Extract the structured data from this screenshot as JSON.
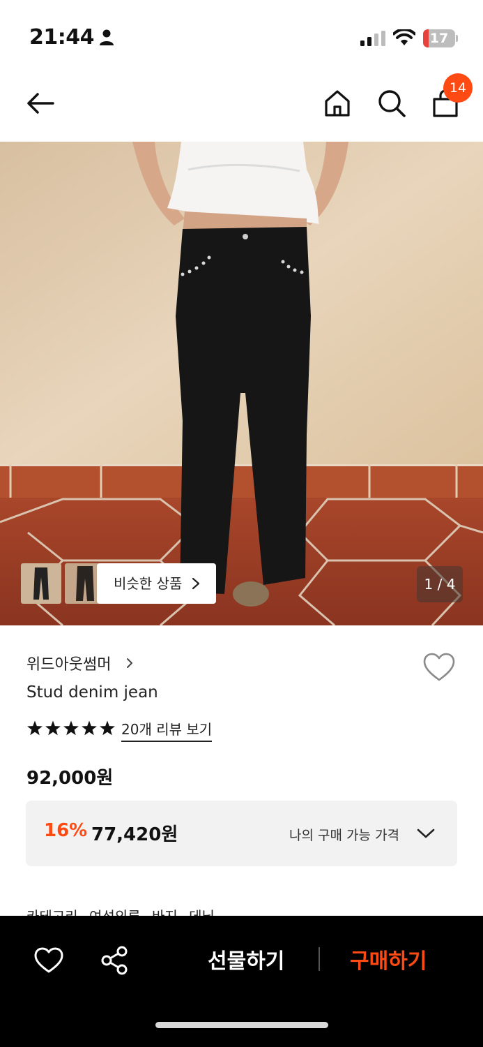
{
  "status_bar": {
    "time": "21:44",
    "battery_level": "17",
    "battery_fraction": 0.17,
    "battery_color": "#e8423a"
  },
  "nav": {
    "cart_count": "14",
    "accent": "#ff4a14"
  },
  "gallery": {
    "similar_label": "비슷한 상품",
    "counter": "1 / 4"
  },
  "product": {
    "brand": "위드아웃썸머",
    "name": "Stud denim jean",
    "rating_stars": 5,
    "review_link": "20개 리뷰 보기",
    "price": "92,000원",
    "discount_percent": "16%",
    "discount_price": "77,420원",
    "my_price_label": "나의 구매 가능 가격",
    "category_label": "카테고리",
    "category_path": [
      "여성의류",
      "바지",
      "데님"
    ]
  },
  "bottom_bar": {
    "gift_label": "선물하기",
    "buy_label": "구매하기"
  },
  "icons": [
    "back-arrow-icon",
    "home-icon",
    "search-icon",
    "shopping-bag-icon",
    "heart-icon",
    "share-icon",
    "chevron-right-icon",
    "chevron-down-icon",
    "star-icon"
  ]
}
